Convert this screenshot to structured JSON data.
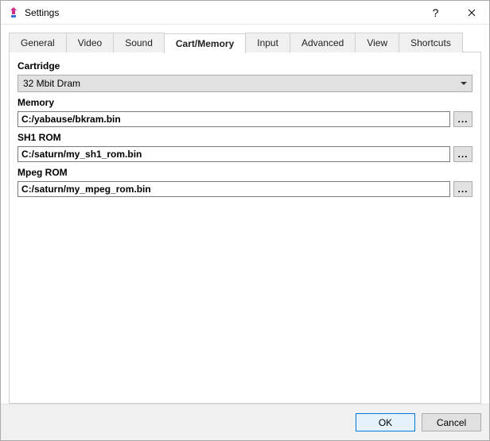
{
  "window": {
    "title": "Settings",
    "help_glyph": "?",
    "close_glyph": "✕"
  },
  "tabs": {
    "general": "General",
    "video": "Video",
    "sound": "Sound",
    "cart_memory": "Cart/Memory",
    "input": "Input",
    "advanced": "Advanced",
    "view": "View",
    "shortcuts": "Shortcuts",
    "active": "cart_memory"
  },
  "cart_memory": {
    "cartridge_label": "Cartridge",
    "cartridge_value": "32 Mbit Dram",
    "memory_label": "Memory",
    "memory_value": "C:/yabause/bkram.bin",
    "sh1_label": "SH1 ROM",
    "sh1_value": "C:/saturn/my_sh1_rom.bin",
    "mpeg_label": "Mpeg ROM",
    "mpeg_value": "C:/saturn/my_mpeg_rom.bin",
    "browse_glyph": "..."
  },
  "footer": {
    "ok": "OK",
    "cancel": "Cancel"
  },
  "colors": {
    "accent": "#0078d7",
    "panel_border": "#d0d0d0",
    "button_face": "#e1e1e1"
  }
}
